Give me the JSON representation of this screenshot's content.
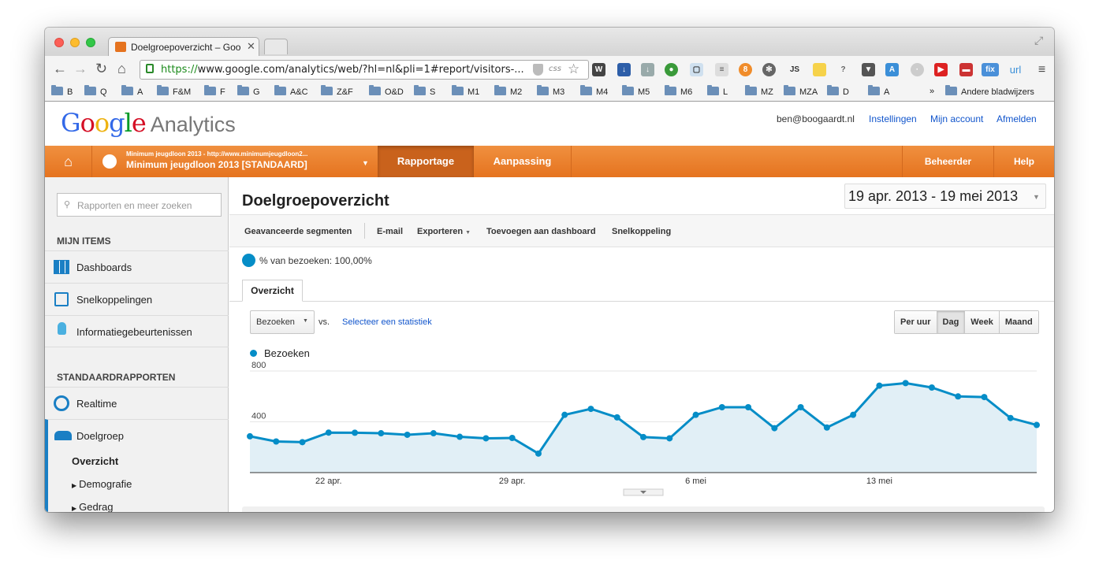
{
  "browser": {
    "tab_title": "Doelgroepoverzicht – Goo",
    "url_secure": "https://",
    "url_rest": "www.google.com/analytics/web/?hl=nl&pli=1#report/visitors-...",
    "ext_labels": {
      "css": "css",
      "js": "JS",
      "fix": "fix",
      "url": "url"
    }
  },
  "bookmarks": {
    "items": [
      "B",
      "Q",
      "A",
      "F&M",
      "F",
      "G",
      "A&C",
      "Z&F",
      "O&D",
      "S",
      "M1",
      "M2",
      "M3",
      "M4",
      "M5",
      "M6",
      "L",
      "MZ",
      "MZA",
      "D",
      "A"
    ],
    "overflow": "»",
    "other": "Andere bladwijzers"
  },
  "header": {
    "logo_letters": [
      {
        "t": "G",
        "c": "#3369e8"
      },
      {
        "t": "o",
        "c": "#d50f25"
      },
      {
        "t": "o",
        "c": "#eeb211"
      },
      {
        "t": "g",
        "c": "#3369e8"
      },
      {
        "t": "l",
        "c": "#009925"
      },
      {
        "t": "e",
        "c": "#d50f25"
      }
    ],
    "logo_suffix": "Analytics",
    "email": "ben@boogaardt.nl",
    "links": [
      "Instellingen",
      "Mijn account",
      "Afmelden"
    ]
  },
  "nav": {
    "account_small": "Minimum jeugdloon 2013 - http://www.minimumjeugdloon2...",
    "account_big": "Minimum jeugdloon 2013 [STANDAARD]",
    "reporting": "Rapportage",
    "customization": "Aanpassing",
    "admin": "Beheerder",
    "help": "Help"
  },
  "sidebar": {
    "search_placeholder": "Rapporten en meer zoeken",
    "my_items": "MIJN ITEMS",
    "items": [
      "Dashboards",
      "Snelkoppelingen",
      "Informatiegebeurtenissen"
    ],
    "standard_reports": "STANDAARDRAPPORTEN",
    "realtime": "Realtime",
    "audience": "Doelgroep",
    "sub": {
      "overview": "Overzicht",
      "demographics": "Demografie",
      "behavior": "Gedrag"
    }
  },
  "main": {
    "title": "Doelgroepoverzicht",
    "date_range": "19 apr. 2013 - 19 mei 2013",
    "actions": [
      "Geavanceerde segmenten",
      "E-mail",
      "Exporteren",
      "Toevoegen aan dashboard",
      "Snelkoppeling"
    ],
    "segment": "% van bezoeken: 100,00%",
    "tab": "Overzicht",
    "metric": "Bezoeken",
    "vs": "vs.",
    "select_metric": "Selecteer een statistiek",
    "periods": [
      "Per uur",
      "Dag",
      "Week",
      "Maand"
    ],
    "active_period": "Dag",
    "legend": "Bezoeken"
  },
  "colors": {
    "accent": "#e5731f",
    "line": "#058dc7",
    "area": "#e1eff6",
    "link": "#15c"
  },
  "chart_data": {
    "type": "area",
    "series": [
      {
        "name": "Bezoeken",
        "values": [
          286,
          245,
          240,
          315,
          314,
          310,
          298,
          310,
          282,
          270,
          273,
          150,
          455,
          502,
          435,
          280,
          270,
          455,
          515,
          515,
          350,
          515,
          355,
          455,
          685,
          705,
          670,
          600,
          595,
          430,
          375
        ]
      }
    ],
    "x": [
      "19 apr.",
      "20 apr.",
      "21 apr.",
      "22 apr.",
      "23 apr.",
      "24 apr.",
      "25 apr.",
      "26 apr.",
      "27 apr.",
      "28 apr.",
      "29 apr.",
      "30 apr.",
      "1 mei",
      "2 mei",
      "3 mei",
      "4 mei",
      "5 mei",
      "6 mei",
      "7 mei",
      "8 mei",
      "9 mei",
      "10 mei",
      "11 mei",
      "12 mei",
      "13 mei",
      "14 mei",
      "15 mei",
      "16 mei",
      "17 mei",
      "18 mei",
      "19 mei"
    ],
    "x_ticks": [
      "22 apr.",
      "29 apr.",
      "6 mei",
      "13 mei"
    ],
    "y_ticks": [
      400,
      800
    ],
    "ylim": [
      0,
      850
    ],
    "grid": true
  }
}
